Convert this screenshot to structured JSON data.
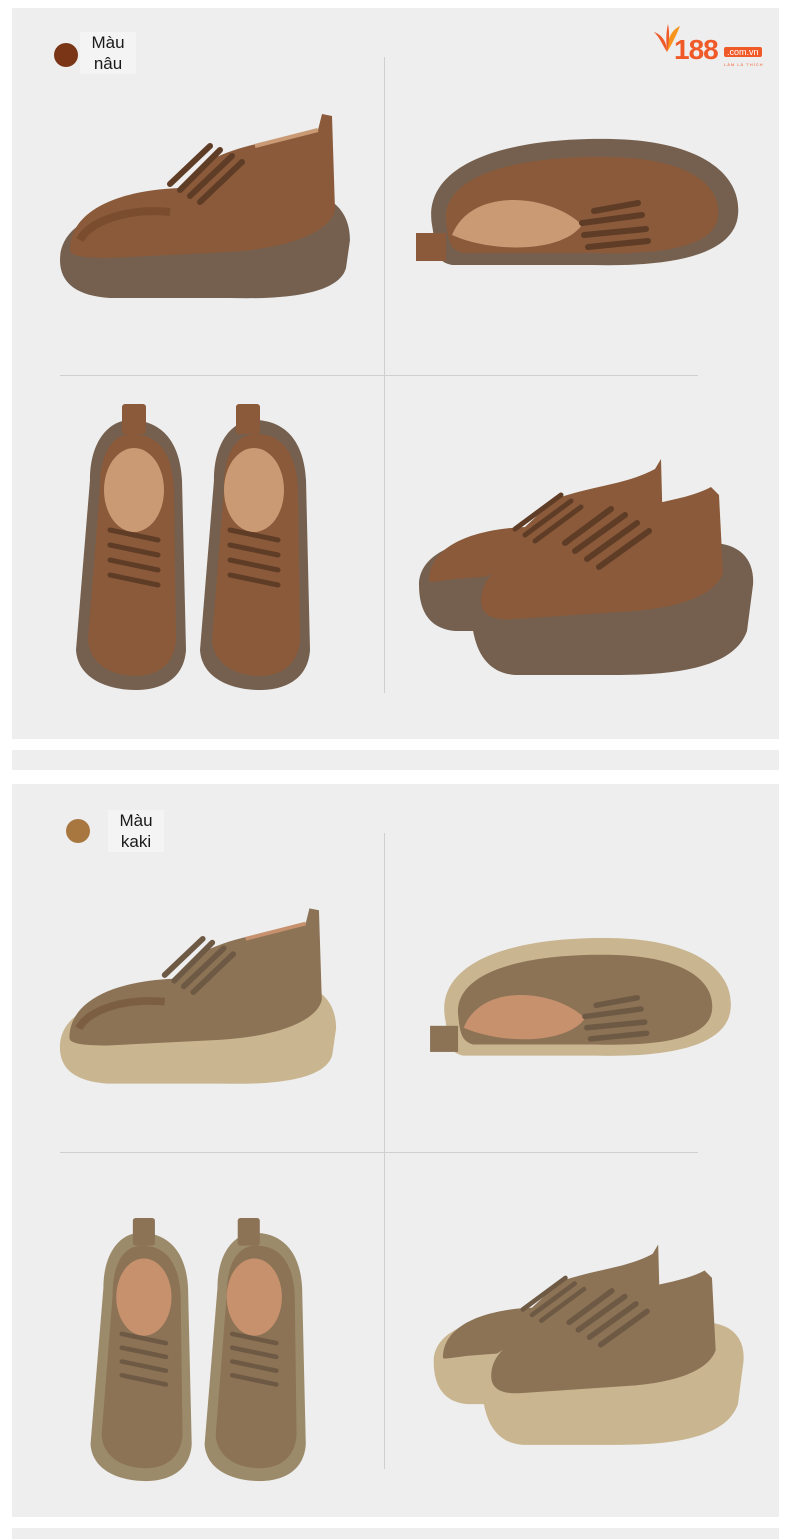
{
  "brand": {
    "number": "188",
    "domain": ".com.vn",
    "tagline": "LÀM LÀ THÍCH",
    "color": "#f05a28"
  },
  "sections": [
    {
      "label_line1": "Màu",
      "label_line2": "nâu",
      "swatch_color": "#7a3416",
      "upper_color": "#8a5a3a",
      "sole_color": "#75604f",
      "lining_color": "#c99a74"
    },
    {
      "label_line1": "Màu",
      "label_line2": "kaki",
      "swatch_color": "#a8773f",
      "upper_color": "#8c7356",
      "sole_color": "#c9b690",
      "lining_color": "#c7916e"
    }
  ]
}
